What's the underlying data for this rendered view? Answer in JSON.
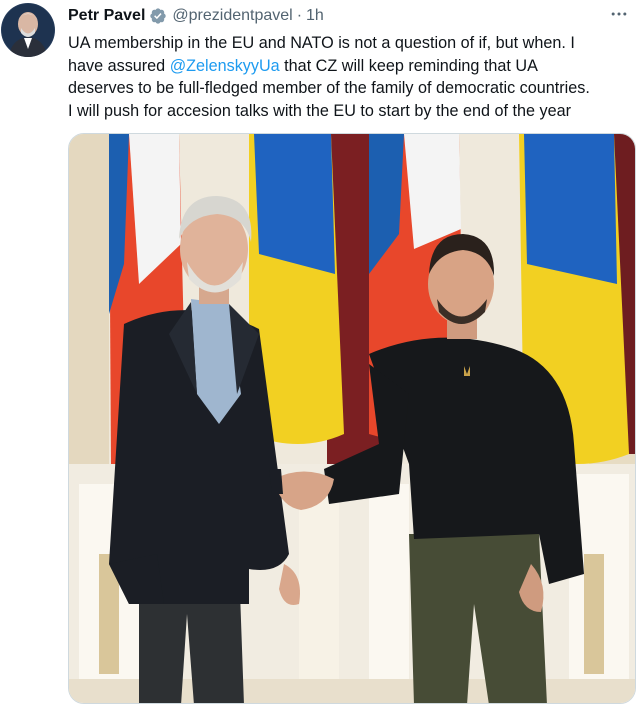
{
  "author": {
    "display_name": "Petr Pavel",
    "handle": "@prezidentpavel",
    "separator": "·",
    "time": "1h",
    "verified_icon": "verified-badge-icon",
    "avatar": "avatar-photo"
  },
  "tweet": {
    "text_line1": "UA membership in the EU and NATO is not a question of if, but when. I",
    "text_line2_pre": "have assured ",
    "mention": "@ZelenskyyUa",
    "text_line2_post": " that CZ will keep reminding that UA",
    "text_line3": "deserves to be full-fledged member of the family of democratic countries.",
    "text_line4": "I will push for accesion talks with the EU to start by the end of the year"
  },
  "media": {
    "description_icon": "photo-handshake-flags"
  },
  "colors": {
    "text": "#0f1419",
    "muted": "#536471",
    "link": "#1d9bf0",
    "verified": "#829aab",
    "flag_blue": "#1a5fb4",
    "flag_yellow": "#f5d327",
    "cz_red": "#e8472b"
  },
  "more_icon": "more-horizontal-icon"
}
